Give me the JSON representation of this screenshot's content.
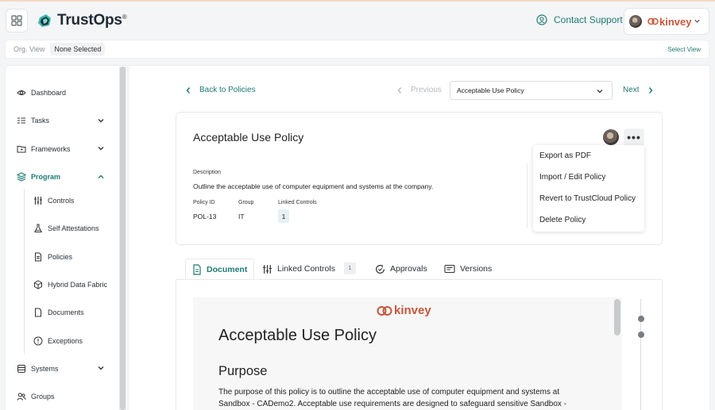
{
  "header": {
    "app_name": "TrustOps",
    "trademark": "®",
    "contact_label": "Contact Support",
    "org_brand": "kinvey"
  },
  "orgbar": {
    "label": "Org. View",
    "value": "None Selected",
    "select_link": "Select View"
  },
  "sidebar": {
    "items": [
      {
        "label": "Dashboard",
        "icon": "eye-icon"
      },
      {
        "label": "Tasks",
        "icon": "tasks-list-icon"
      },
      {
        "label": "Frameworks",
        "icon": "folder-icon"
      },
      {
        "label": "Program",
        "icon": "layers-icon"
      },
      {
        "label": "Systems",
        "icon": "database-icon"
      },
      {
        "label": "Groups",
        "icon": "users-icon"
      }
    ],
    "sub_items": [
      {
        "label": "Controls",
        "icon": "sliders-icon"
      },
      {
        "label": "Self Attestations",
        "icon": "flask-icon"
      },
      {
        "label": "Policies",
        "icon": "document-icon"
      },
      {
        "label": "Hybrid Data Fabric",
        "icon": "cube-icon"
      },
      {
        "label": "Documents",
        "icon": "file-icon"
      },
      {
        "label": "Exceptions",
        "icon": "alert-circle-icon"
      }
    ]
  },
  "nav": {
    "back": "Back to Policies",
    "previous": "Previous",
    "selected_policy": "Acceptable Use Policy",
    "next": "Next"
  },
  "policy": {
    "title": "Acceptable Use Policy",
    "more": "•••",
    "description_label": "Description",
    "description": "Outline the acceptable use of computer equipment and systems at the company.",
    "id_label": "Policy ID",
    "id": "POL-13",
    "group_label": "Group",
    "group": "IT",
    "linked_label": "Linked Controls",
    "linked_count": "1"
  },
  "menu": {
    "items": [
      "Export as PDF",
      "Import / Edit Policy",
      "Revert to TrustCloud Policy",
      "Delete Policy"
    ]
  },
  "tabs": {
    "document": "Document",
    "linked_controls": "Linked Controls",
    "linked_count": "1",
    "approvals": "Approvals",
    "versions": "Versions"
  },
  "doc": {
    "brand": "kinvey",
    "title": "Acceptable Use Policy",
    "heading": "Purpose",
    "body": "The purpose of this policy is to outline the acceptable use of computer equipment and systems at Sandbox - CADemo2. Acceptable use requirements are designed to safeguard sensitive Sandbox -"
  },
  "colors": {
    "accent": "#1e7a73",
    "brand": "#c6563a"
  }
}
